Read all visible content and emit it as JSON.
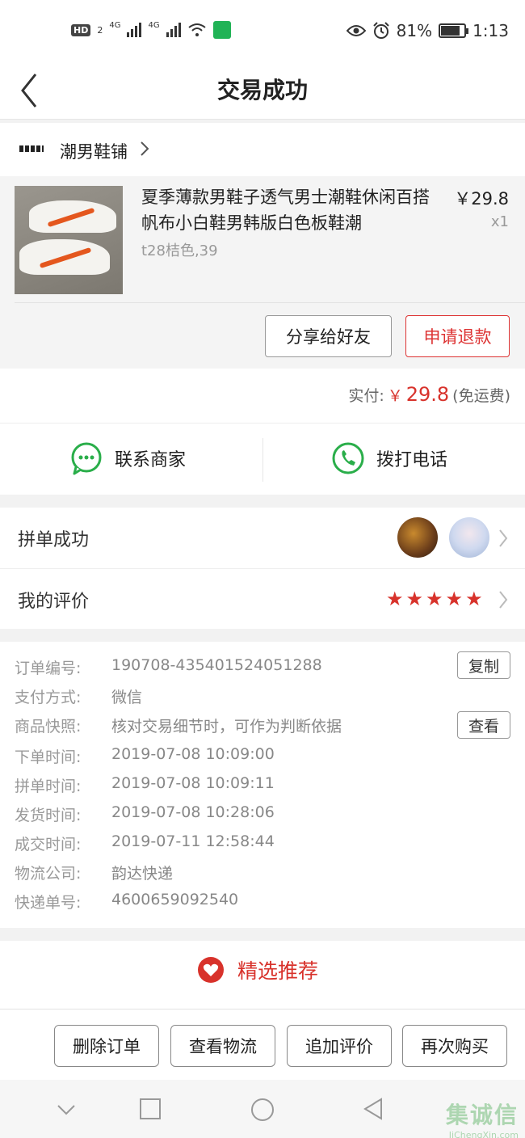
{
  "status_bar": {
    "network_badge": "HD",
    "network_sub": "2",
    "signal_label_1": "4G",
    "signal_label_2": "4G",
    "battery": "81%",
    "battery_level": 0.81,
    "time": "1:13"
  },
  "header": {
    "title": "交易成功"
  },
  "shop": {
    "name": "潮男鞋铺"
  },
  "product": {
    "title": "夏季薄款男鞋子透气男士潮鞋休闲百搭帆布小白鞋男韩版白色板鞋潮",
    "spec": "t28桔色,39",
    "price": "￥29.8",
    "qty": "x1",
    "share_label": "分享给好友",
    "refund_label": "申请退款"
  },
  "payment": {
    "label": "实付:",
    "currency": "￥",
    "amount": "29.8",
    "shipping_note": "(免运费)"
  },
  "contact": {
    "merchant_label": "联系商家",
    "phone_label": "拨打电话"
  },
  "group": {
    "group_label": "拼单成功",
    "review_label": "我的评价",
    "rating": 5
  },
  "order_info": {
    "rows": [
      {
        "key": "订单编号:",
        "value": "190708-435401524051288"
      },
      {
        "key": "支付方式:",
        "value": "微信"
      },
      {
        "key": "商品快照:",
        "value": "核对交易细节时，可作为判断依据"
      },
      {
        "key": "下单时间:",
        "value": "2019-07-08 10:09:00"
      },
      {
        "key": "拼单时间:",
        "value": "2019-07-08 10:09:11"
      },
      {
        "key": "发货时间:",
        "value": "2019-07-08 10:28:06"
      },
      {
        "key": "成交时间:",
        "value": "2019-07-11 12:58:44"
      },
      {
        "key": "物流公司:",
        "value": "韵达快递"
      },
      {
        "key": "快递单号:",
        "value": "4600659092540"
      }
    ],
    "copy_label": "复制",
    "view_label": "查看"
  },
  "recommend": {
    "title": "精选推荐"
  },
  "actions": {
    "delete_label": "删除订单",
    "logistics_label": "查看物流",
    "add_review_label": "追加评价",
    "rebuy_label": "再次购买"
  },
  "watermark": {
    "main": "集诚信",
    "sub": "JiChengXin.com"
  },
  "colors": {
    "accent": "#d8322b",
    "wechat_green": "#21b356",
    "icon_green": "#2aae4a"
  }
}
